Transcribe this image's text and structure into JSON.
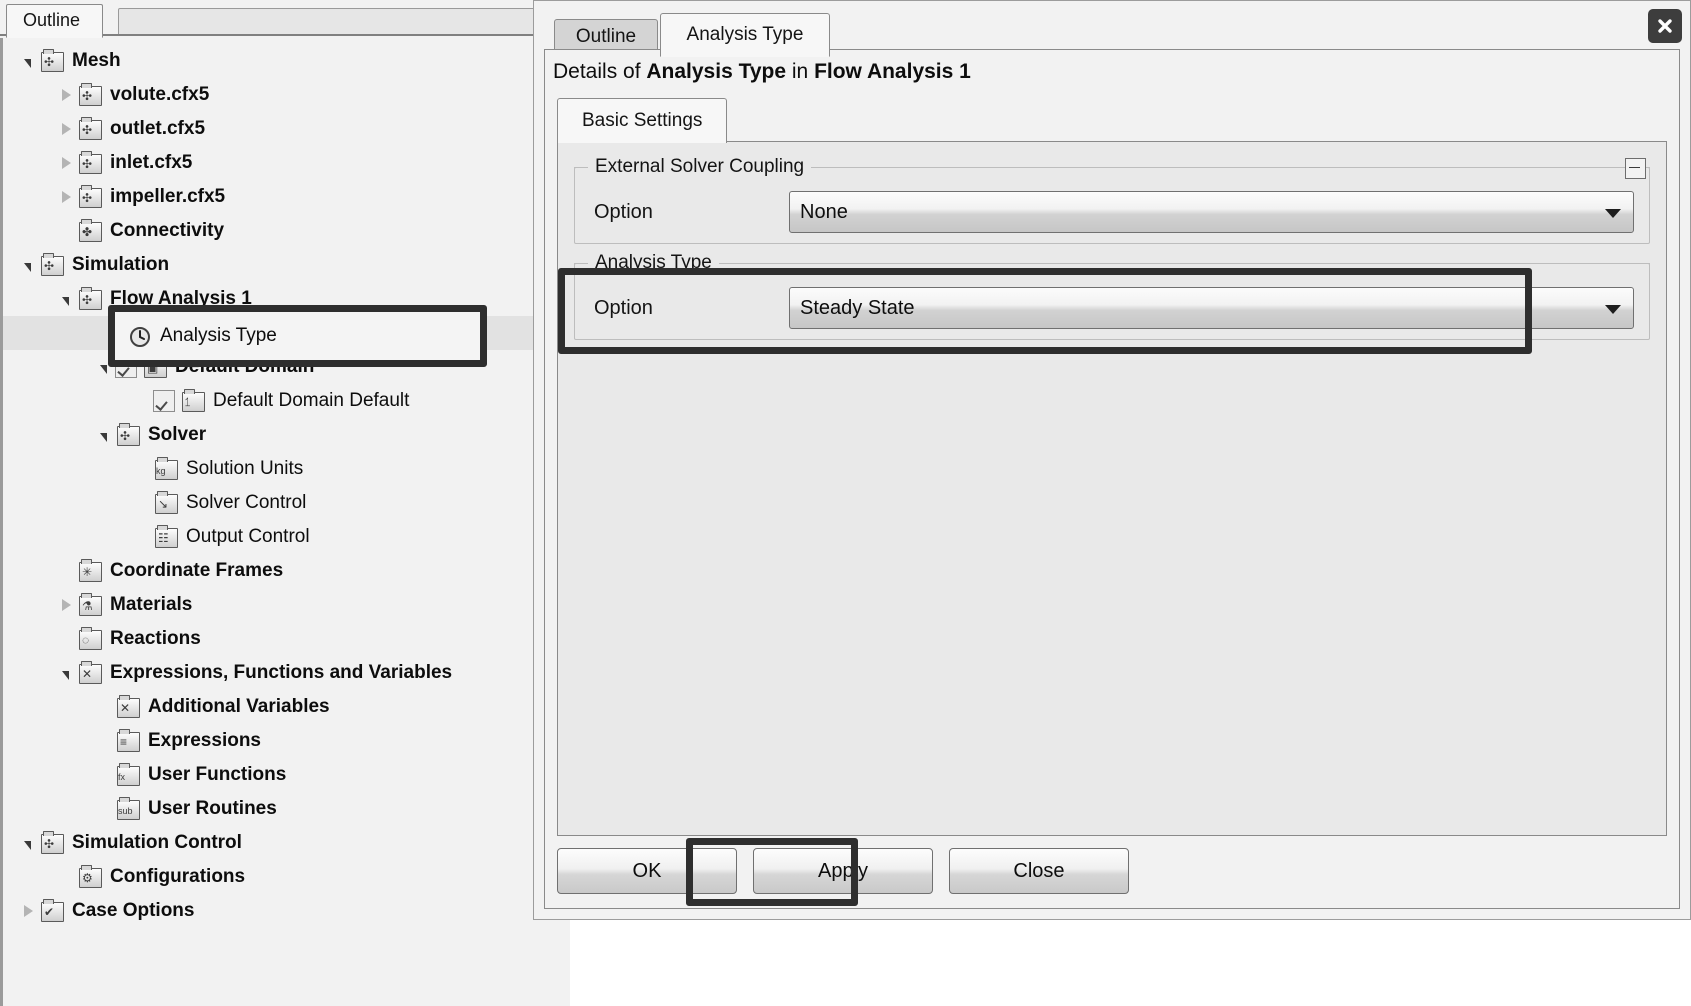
{
  "outline_panel": {
    "tab_label": "Outline",
    "tree": [
      {
        "label": "Mesh",
        "depth": 0,
        "twist": "open",
        "bold": true,
        "icon": "mesh-folder-icon",
        "glyph": "✣"
      },
      {
        "label": "volute.cfx5",
        "depth": 1,
        "twist": "closed",
        "bold": true,
        "icon": "mesh-folder-icon",
        "glyph": "✣"
      },
      {
        "label": "outlet.cfx5",
        "depth": 1,
        "twist": "closed",
        "bold": true,
        "icon": "mesh-folder-icon",
        "glyph": "✣"
      },
      {
        "label": "inlet.cfx5",
        "depth": 1,
        "twist": "closed",
        "bold": true,
        "icon": "mesh-folder-icon",
        "glyph": "✣"
      },
      {
        "label": "impeller.cfx5",
        "depth": 1,
        "twist": "closed",
        "bold": true,
        "icon": "mesh-folder-icon",
        "glyph": "✣"
      },
      {
        "label": "Connectivity",
        "depth": 1,
        "twist": "none",
        "bold": true,
        "icon": "connectivity-icon",
        "glyph": "✤"
      },
      {
        "label": "Simulation",
        "depth": 0,
        "twist": "open",
        "bold": true,
        "icon": "simulation-folder-icon",
        "glyph": "✣"
      },
      {
        "label": "Flow Analysis 1",
        "depth": 1,
        "twist": "open",
        "bold": true,
        "icon": "flow-analysis-folder-icon",
        "glyph": "✣"
      },
      {
        "label": "Analysis Type",
        "depth": 2,
        "twist": "none",
        "bold": false,
        "icon": "clock-icon",
        "glyph": "◴",
        "selected": true
      },
      {
        "label": "Default Domain",
        "depth": 2,
        "twist": "open",
        "bold": true,
        "icon": "domain-icon",
        "glyph": "▣",
        "checkbox": true
      },
      {
        "label": "Default Domain Default",
        "depth": 3,
        "twist": "none",
        "bold": false,
        "icon": "boundary-icon",
        "glyph": "⥠",
        "checkbox": true
      },
      {
        "label": "Solver",
        "depth": 2,
        "twist": "open",
        "bold": true,
        "icon": "solver-folder-icon",
        "glyph": "✣"
      },
      {
        "label": "Solution Units",
        "depth": 3,
        "twist": "none",
        "bold": false,
        "icon": "solution-units-icon",
        "glyph": "kg"
      },
      {
        "label": "Solver Control",
        "depth": 3,
        "twist": "none",
        "bold": false,
        "icon": "solver-control-icon",
        "glyph": "↘"
      },
      {
        "label": "Output Control",
        "depth": 3,
        "twist": "none",
        "bold": false,
        "icon": "output-control-icon",
        "glyph": "☷"
      },
      {
        "label": "Coordinate Frames",
        "depth": 1,
        "twist": "none",
        "bold": true,
        "icon": "coordinate-frames-icon",
        "glyph": "✳"
      },
      {
        "label": "Materials",
        "depth": 1,
        "twist": "closed",
        "bold": true,
        "icon": "materials-icon",
        "glyph": "⚗"
      },
      {
        "label": "Reactions",
        "depth": 1,
        "twist": "none",
        "bold": true,
        "icon": "reactions-icon",
        "glyph": "◌"
      },
      {
        "label": "Expressions, Functions and Variables",
        "depth": 1,
        "twist": "open",
        "bold": true,
        "icon": "expressions-icon",
        "glyph": "✕"
      },
      {
        "label": "Additional Variables",
        "depth": 2,
        "twist": "none",
        "bold": true,
        "icon": "additional-variables-icon",
        "glyph": "✕"
      },
      {
        "label": "Expressions",
        "depth": 2,
        "twist": "none",
        "bold": true,
        "icon": "expressions-folder-icon",
        "glyph": "≡"
      },
      {
        "label": "User Functions",
        "depth": 2,
        "twist": "none",
        "bold": true,
        "icon": "user-functions-icon",
        "glyph": "fx"
      },
      {
        "label": "User Routines",
        "depth": 2,
        "twist": "none",
        "bold": true,
        "icon": "user-routines-icon",
        "glyph": "sub"
      },
      {
        "label": "Simulation Control",
        "depth": 0,
        "twist": "open",
        "bold": true,
        "icon": "simulation-control-icon",
        "glyph": "✣"
      },
      {
        "label": "Configurations",
        "depth": 1,
        "twist": "none",
        "bold": true,
        "icon": "configurations-icon",
        "glyph": "⚙"
      },
      {
        "label": "Case Options",
        "depth": 0,
        "twist": "closed",
        "bold": true,
        "icon": "case-options-icon",
        "glyph": "✔"
      }
    ]
  },
  "details_window": {
    "close_icon": "close-icon",
    "tabs": [
      {
        "label": "Outline",
        "active": false
      },
      {
        "label": "Analysis Type",
        "active": true
      }
    ],
    "title_prefix": "Details of ",
    "title_entity": "Analysis Type",
    "title_middle": " in ",
    "title_context": "Flow Analysis 1",
    "settings_tab": "Basic Settings",
    "groups": [
      {
        "name": "External Solver Coupling",
        "collapse_icon": "collapse-minus-icon",
        "fields": [
          {
            "label": "Option",
            "value": "None",
            "control": "dropdown",
            "arrow_icon": "chevron-down-icon"
          }
        ]
      },
      {
        "name": "Analysis Type",
        "fields": [
          {
            "label": "Option",
            "value": "Steady State",
            "control": "dropdown",
            "arrow_icon": "chevron-down-icon"
          }
        ]
      }
    ],
    "buttons": [
      {
        "label": "OK",
        "name": "ok-button"
      },
      {
        "label": "Apply",
        "name": "apply-button",
        "highlighted": true
      },
      {
        "label": "Close",
        "name": "close-button"
      }
    ]
  },
  "annotations": {
    "highlight_color": "#2e2e2e",
    "targets": [
      "Analysis Type tree item",
      "Analysis Type option row",
      "Apply button"
    ]
  }
}
